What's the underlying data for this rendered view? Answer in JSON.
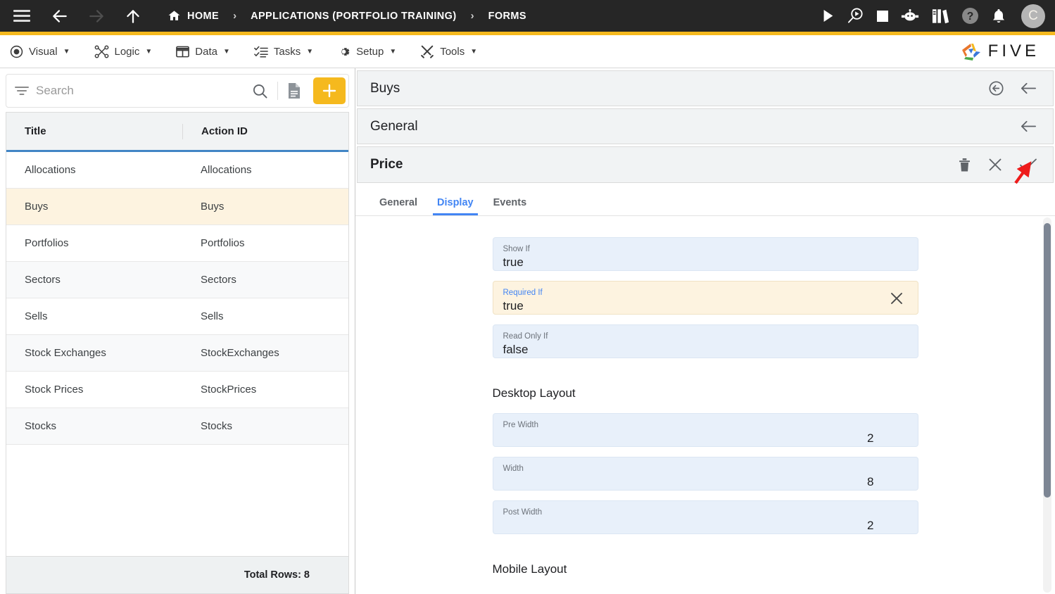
{
  "topbar": {
    "menu_icon": "hamburger-icon",
    "back_label": "back-arrow-icon",
    "forward_label": "forward-arrow-icon",
    "up_label": "up-arrow-icon",
    "breadcrumb": [
      {
        "label": "HOME",
        "icon": "home-icon"
      },
      {
        "label": "APPLICATIONS (PORTFOLIO TRAINING)",
        "icon": ""
      },
      {
        "label": "FORMS",
        "icon": ""
      }
    ],
    "separator": "›",
    "actions": [
      {
        "name": "run-icon",
        "title": "Run"
      },
      {
        "name": "debug-icon",
        "title": "Debug"
      },
      {
        "name": "stop-icon",
        "title": "Stop"
      },
      {
        "name": "chatbot-icon",
        "title": "Assistant"
      },
      {
        "name": "library-icon",
        "title": "Documentation"
      },
      {
        "name": "help-icon",
        "title": "Help"
      },
      {
        "name": "bell-icon",
        "title": "Notifications"
      }
    ],
    "avatar_initial": "C",
    "accent_color": "#f5b91e",
    "background_color": "#262626"
  },
  "menubar": {
    "items": [
      {
        "label": "Visual",
        "icon": "eye-icon",
        "caret": "▼"
      },
      {
        "label": "Logic",
        "icon": "logic-icon",
        "caret": "▼"
      },
      {
        "label": "Data",
        "icon": "table-icon",
        "caret": "▼"
      },
      {
        "label": "Tasks",
        "icon": "tasks-icon",
        "caret": "▼"
      },
      {
        "label": "Setup",
        "icon": "gear-icon",
        "caret": "▼"
      },
      {
        "label": "Tools",
        "icon": "tools-icon",
        "caret": "▼"
      }
    ],
    "brand": "FIVE"
  },
  "left_panel": {
    "search": {
      "placeholder": "Search",
      "value": ""
    },
    "toolbar": {
      "filter_icon": "filter-icon",
      "search_icon": "search-icon",
      "document_icon": "document-icon",
      "add_icon": "+"
    },
    "table": {
      "columns": [
        "Title",
        "Action ID"
      ],
      "rows": [
        {
          "title": "Allocations",
          "action_id": "Allocations"
        },
        {
          "title": "Buys",
          "action_id": "Buys"
        },
        {
          "title": "Portfolios",
          "action_id": "Portfolios"
        },
        {
          "title": "Sectors",
          "action_id": "Sectors"
        },
        {
          "title": "Sells",
          "action_id": "Sells"
        },
        {
          "title": "Stock Exchanges",
          "action_id": "StockExchanges"
        },
        {
          "title": "Stock Prices",
          "action_id": "StockPrices"
        },
        {
          "title": "Stocks",
          "action_id": "Stocks"
        }
      ],
      "selected_index": 1,
      "footer": "Total Rows: 8"
    }
  },
  "right_panel": {
    "headers": [
      {
        "title": "Buys",
        "actions": [
          "circle-back-icon",
          "back-arrow-icon"
        ]
      },
      {
        "title": "General",
        "actions": [
          "back-arrow-icon"
        ]
      },
      {
        "title": "Price",
        "actions": [
          "delete-icon",
          "cancel-icon",
          "save-icon"
        ]
      }
    ],
    "tabs": [
      {
        "label": "General",
        "active": false
      },
      {
        "label": "Display",
        "active": true
      },
      {
        "label": "Events",
        "active": false
      }
    ],
    "fields": [
      {
        "label": "Show If",
        "value": "true",
        "type": "text",
        "focused": false,
        "clearable": false
      },
      {
        "label": "Required If",
        "value": "true",
        "type": "text",
        "focused": true,
        "clearable": true
      },
      {
        "label": "Read Only If",
        "value": "false",
        "type": "text",
        "focused": false,
        "clearable": false
      }
    ],
    "desktop_section": "Desktop Layout",
    "desktop_fields": [
      {
        "label": "Pre Width",
        "value": "2"
      },
      {
        "label": "Width",
        "value": "8"
      },
      {
        "label": "Post Width",
        "value": "2"
      }
    ],
    "mobile_section": "Mobile Layout",
    "accent_blue": "#4285f4",
    "field_bg": "#e8f0fa",
    "focused_bg": "#fdf3e0"
  },
  "annotation": {
    "arrow_color": "#ee1b1b",
    "points_to": "save-icon"
  }
}
